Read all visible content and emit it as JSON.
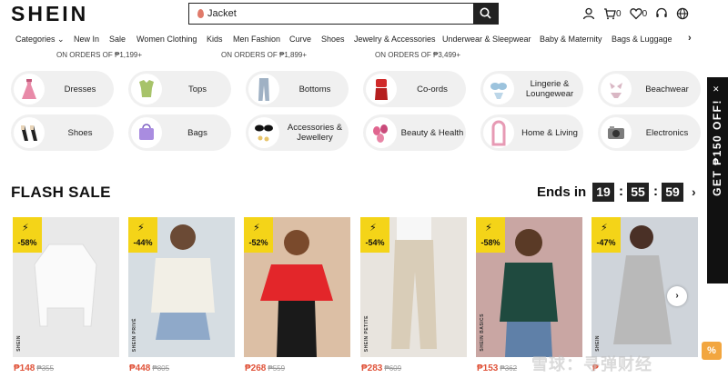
{
  "header": {
    "logo": "SHEIN",
    "search_value": "Jacket",
    "cart_count": "0",
    "wishlist_count": "0"
  },
  "nav": {
    "items": [
      "Categories",
      "New In",
      "Sale",
      "Women Clothing",
      "Kids",
      "Men Fashion",
      "Curve",
      "Shoes",
      "Jewelry & Accessories",
      "Underwear & Sleepwear",
      "Baby & Maternity",
      "Bags & Luggage"
    ],
    "next": "›"
  },
  "promos": [
    "ON ORDERS OF ₱1,199+",
    "ON ORDERS OF ₱1,899+",
    "ON ORDERS OF ₱3,499+"
  ],
  "categories": [
    {
      "label": "Dresses",
      "icon": "dress-icon"
    },
    {
      "label": "Tops",
      "icon": "top-icon"
    },
    {
      "label": "Bottoms",
      "icon": "pants-icon"
    },
    {
      "label": "Co-ords",
      "icon": "coords-icon"
    },
    {
      "label": "Lingerie & Loungewear",
      "icon": "lingerie-icon"
    },
    {
      "label": "Beachwear",
      "icon": "bikini-icon"
    },
    {
      "label": "Shoes",
      "icon": "shoes-icon"
    },
    {
      "label": "Bags",
      "icon": "bag-icon"
    },
    {
      "label": "Accessories & Jewellery",
      "icon": "sunglasses-icon"
    },
    {
      "label": "Beauty & Health",
      "icon": "beauty-icon"
    },
    {
      "label": "Home & Living",
      "icon": "mirror-icon"
    },
    {
      "label": "Electronics",
      "icon": "camera-icon"
    }
  ],
  "flash": {
    "title": "FLASH SALE",
    "ends_label": "Ends in",
    "hours": "19",
    "minutes": "55",
    "seconds": "59",
    "arrow": "›"
  },
  "products": [
    {
      "discount": "-58%",
      "brand": "SHEIN",
      "price": "₱148",
      "old": "₱355",
      "color": "#ececec"
    },
    {
      "discount": "-44%",
      "brand": "SHEIN PRIVÉ",
      "price": "₱448",
      "old": "₱805",
      "color": "#cfd8de"
    },
    {
      "discount": "-52%",
      "brand": "SHEIN",
      "price": "₱268",
      "old": "₱559",
      "color": "#d8b59a"
    },
    {
      "discount": "-54%",
      "brand": "SHEIN PETITE",
      "price": "₱283",
      "old": "₱609",
      "color": "#e6e1da"
    },
    {
      "discount": "-58%",
      "brand": "SHEIN BASICS",
      "price": "₱153",
      "old": "₱362",
      "color": "#c7a3a0"
    },
    {
      "discount": "-47%",
      "brand": "SHEIN",
      "price": "₱",
      "old": "",
      "color": "#c9cfd6"
    }
  ],
  "side_tab": {
    "text": "GET ₱150 OFF!",
    "close": "✕"
  },
  "watermark": "雪球：寻弹财经"
}
